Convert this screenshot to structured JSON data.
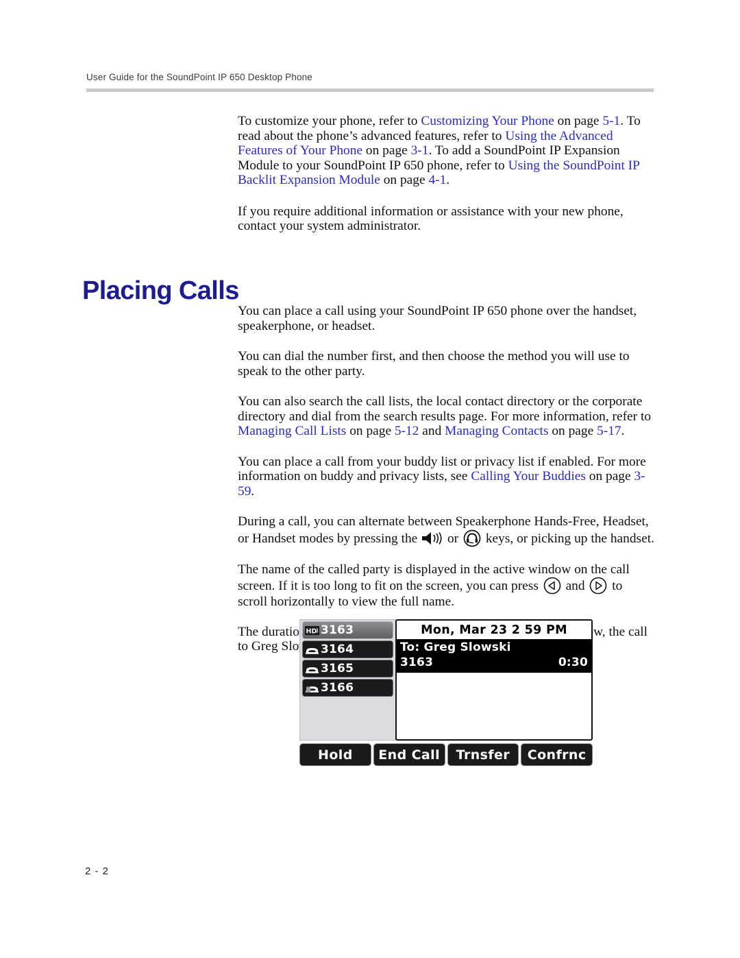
{
  "header": {
    "running_head": "User Guide for the SoundPoint IP 650 Desktop Phone"
  },
  "intro": {
    "p1": {
      "seg1": "To customize your phone, refer to ",
      "link1": "Customizing Your Phone",
      "seg2": " on page ",
      "link2": "5-1",
      "seg3": ". To read about the phone’s advanced features, refer to ",
      "link3": "Using the Advanced Features of Your Phone",
      "seg4": " on page ",
      "link4": "3-1",
      "seg5": ". To add a SoundPoint IP Expansion Module to your SoundPoint IP 650 phone, refer to ",
      "link5": "Using the SoundPoint IP Backlit Expansion Module",
      "seg6": " on page ",
      "link6": "4-1",
      "seg7": "."
    },
    "p2": "If you require additional information or assistance with your new phone, contact your system administrator."
  },
  "section": {
    "heading": "Placing Calls"
  },
  "placing_calls": {
    "p1": "You can place a call using your SoundPoint IP 650 phone over the handset, speakerphone, or headset.",
    "p2": "You can dial the number first, and then choose the method you will use to speak to the other party.",
    "p3": {
      "seg1": "You can also search the call lists, the local contact directory or the corporate directory and dial from the search results page. For more information, refer to ",
      "link1": "Managing Call Lists",
      "seg2": " on page ",
      "link2": "5-12",
      "seg3": " and ",
      "link3": "Managing Contacts",
      "seg4": " on page ",
      "link4": "5-17",
      "seg5": "."
    },
    "p4": {
      "seg1": "You can place a call from your buddy list or privacy list if enabled. For more information on buddy and privacy lists, see ",
      "link1": "Calling Your Buddies",
      "seg2": " on page ",
      "link2": "3-59",
      "seg3": "."
    },
    "p5": {
      "seg1": "During a call, you can alternate between Speakerphone Hands-Free, Headset, or Handset modes by pressing the ",
      "icon1": "speakerphone-icon",
      "seg2": " or ",
      "icon2": "headset-icon",
      "seg3": " keys, or picking up the handset."
    },
    "p6": {
      "seg1": "The name of the called party is displayed in the active window on the call screen. If it is too long to fit on the screen, you can press ",
      "icon1": "arrow-left-icon",
      "seg2": " and ",
      "icon2": "arrow-right-icon",
      "seg3": " to scroll horizontally to view the full name."
    },
    "p7": "The duration of calls is visible on the call screen. In the figure below, the call to Greg Slowski has lasted 30 seconds so far."
  },
  "phone_figure": {
    "line_keys": [
      {
        "icon": "hd-audio-icon",
        "label": "3163",
        "active": true
      },
      {
        "icon": "phone-handset-icon",
        "label": "3164",
        "active": false
      },
      {
        "icon": "phone-handset-icon",
        "label": "3165",
        "active": false
      },
      {
        "icon": "phone-handset-icon",
        "label": "3166",
        "active": false
      }
    ],
    "status_bar": "Mon, Mar 23  2 59 PM",
    "active_call": {
      "to_label": "To: Greg Slowski",
      "line": "3163",
      "duration": "0:30"
    },
    "soft_keys": [
      "Hold",
      "End Call",
      "Trnsfer",
      "Confrnc"
    ]
  },
  "footer": {
    "page_number": "2 - 2"
  },
  "colors": {
    "link_blue": "#2a2ac8",
    "heading_blue": "#1d1d8f",
    "rule_gray": "#c9c9c9",
    "screen_black": "#000000",
    "linekey_panel": "#dcdce0"
  }
}
